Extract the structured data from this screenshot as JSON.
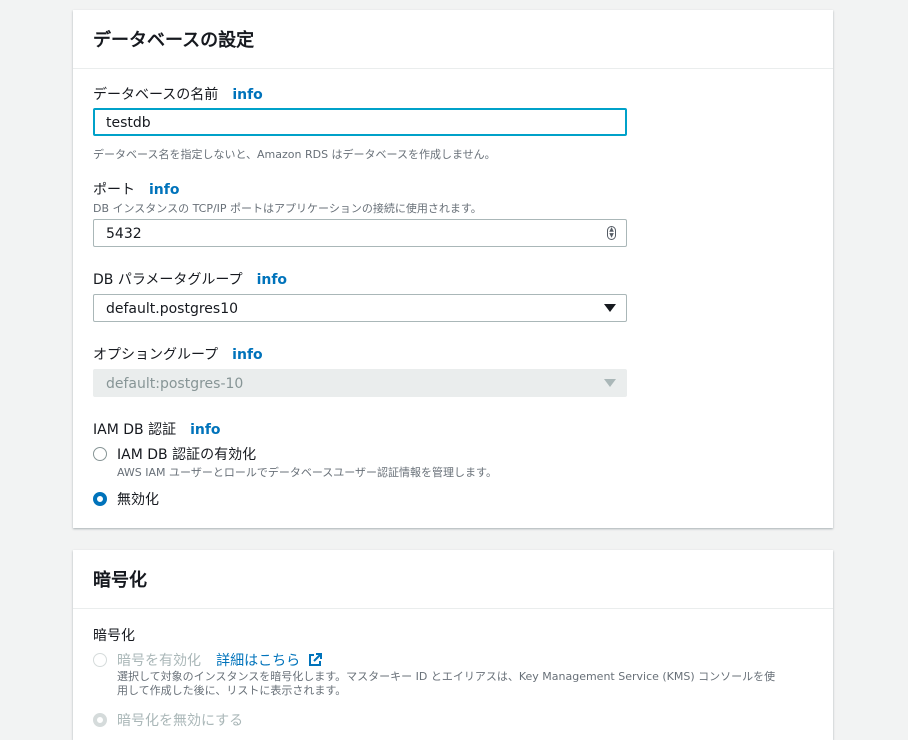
{
  "db_settings": {
    "title": "データベースの設定",
    "db_name": {
      "label": "データベースの名前",
      "info": "info",
      "value": "testdb",
      "hint": "データベース名を指定しないと、Amazon RDS はデータベースを作成しません。"
    },
    "port": {
      "label": "ポート",
      "info": "info",
      "hint": "DB インスタンスの TCP/IP ポートはアプリケーションの接続に使用されます。",
      "value": "5432"
    },
    "param_group": {
      "label": "DB パラメータグループ",
      "info": "info",
      "selected": "default.postgres10"
    },
    "option_group": {
      "label": "オプショングループ",
      "info": "info",
      "selected": "default:postgres-10"
    },
    "iam_auth": {
      "label": "IAM DB 認証",
      "info": "info",
      "options": [
        {
          "label": "IAM DB 認証の有効化",
          "description": "AWS IAM ユーザーとロールでデータベースユーザー認証情報を管理します。",
          "checked": false
        },
        {
          "label": "無効化",
          "checked": true
        }
      ]
    }
  },
  "encryption": {
    "title": "暗号化",
    "label": "暗号化",
    "enable": {
      "label": "暗号を有効化",
      "link": "詳細はこちら",
      "description_line1": "選択して対象のインスタンスを暗号化します。マスターキー ID とエイリアスは、Key Management Service (KMS) コンソールを使",
      "description_line2": "用して作成した後に、リストに表示されます。"
    },
    "disable": {
      "label": "暗号化を無効にする"
    }
  },
  "colors": {
    "link": "#0073bb",
    "focus": "#00a1c9",
    "background": "#f2f3f3"
  },
  "icons": {
    "select_caret": "caret-down-icon",
    "number_spinner": "spinner-icon",
    "external_link": "external-link-icon"
  }
}
